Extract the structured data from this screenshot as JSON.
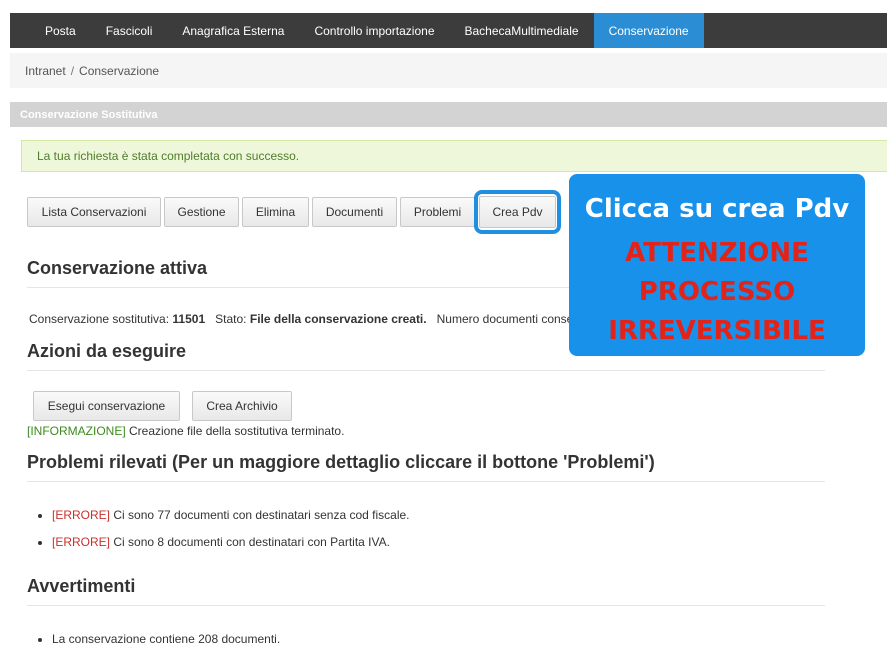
{
  "nav": {
    "items": [
      {
        "label": "Posta",
        "active": false
      },
      {
        "label": "Fascicoli",
        "active": false
      },
      {
        "label": "Anagrafica Esterna",
        "active": false
      },
      {
        "label": "Controllo importazione",
        "active": false
      },
      {
        "label": "BachecaMultimediale",
        "active": false
      },
      {
        "label": "Conservazione",
        "active": true
      }
    ]
  },
  "breadcrumb": {
    "root": "Intranet",
    "separator": "/",
    "current": "Conservazione"
  },
  "panel": {
    "title": "Conservazione Sostitutiva"
  },
  "alert": {
    "message": "La tua richiesta è stata completata con successo."
  },
  "toolbar": {
    "lista": "Lista Conservazioni",
    "gestione": "Gestione",
    "elimina": "Elimina",
    "documenti": "Documenti",
    "problemi": "Problemi",
    "crea_pdv": "Crea Pdv"
  },
  "active_section": {
    "title": "Conservazione attiva",
    "id_label": "Conservazione sostitutiva:",
    "id_value": "11501",
    "status_label": "Stato:",
    "status_value": "File della conservazione creati.",
    "count_label": "Numero documenti conse"
  },
  "actions": {
    "title": "Azioni da eseguire",
    "esegui": "Esegui conservazione",
    "crea_archivio": "Crea Archivio",
    "log_tag": "[INFORMAZIONE]",
    "log_text": " Creazione file della sostitutiva terminato."
  },
  "problems": {
    "title": "Problemi rilevati (Per un maggiore dettaglio cliccare il bottone 'Problemi')",
    "items": [
      {
        "tag": "[ERRORE]",
        "text": " Ci sono 77 documenti con destinatari senza cod fiscale."
      },
      {
        "tag": "[ERRORE]",
        "text": " Ci sono 8 documenti con destinatari con Partita IVA."
      }
    ]
  },
  "warnings": {
    "title": "Avvertimenti",
    "items": [
      "La conservazione contiene 208 documenti."
    ]
  },
  "callout": {
    "title": "Clicca su crea Pdv",
    "warning_lines": [
      "ATTENZIONE",
      "PROCESSO",
      "IRREVERSIBILE"
    ]
  },
  "colors": {
    "nav_bg": "#3c3c3c",
    "nav_active": "#2b8ed4",
    "callout_bg": "#1891ea",
    "callout_warn": "#e2231a",
    "success_bg": "#eff7db",
    "error_text": "#c9302c"
  }
}
